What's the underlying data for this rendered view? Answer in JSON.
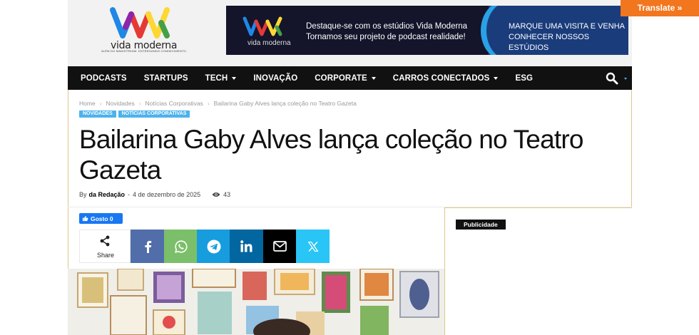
{
  "brand": {
    "logo_text": "vida moderna",
    "logo_tagline": "ALÉM DO MAINSTREAM. ENTREGANDO CONHECIMENTO.",
    "logo_colors": [
      "#1e88e5",
      "#e53935",
      "#fdd835",
      "#43a047",
      "#8e24aa"
    ]
  },
  "banner": {
    "logo_text": "vida moderna",
    "headline_line1": "Destaque-se com os estúdios Vida Moderna",
    "headline_line2": "Tornamos seu projeto de podcast realidade!",
    "cta_line1": "MARQUE UMA VISITA E VENHA",
    "cta_line2": "CONHECER NOSSOS ESTÚDIOS"
  },
  "translate": {
    "label": "Translate »"
  },
  "nav": {
    "items": [
      {
        "label": "PODCASTS",
        "dropdown": false
      },
      {
        "label": "STARTUPS",
        "dropdown": false
      },
      {
        "label": "TECH",
        "dropdown": true
      },
      {
        "label": "INOVAÇÃO",
        "dropdown": false
      },
      {
        "label": "CORPORATE",
        "dropdown": true
      },
      {
        "label": "CARROS CONECTADOS",
        "dropdown": true
      },
      {
        "label": "ESG",
        "dropdown": false
      }
    ],
    "search_icon": "search-icon"
  },
  "breadcrumb": {
    "items": [
      "Home",
      "Novidades",
      "Notícias Corporativas",
      "Bailarina Gaby Alves lança coleção no Teatro Gazeta"
    ],
    "separator": "›"
  },
  "tags": [
    "NOVIDADES",
    "NOTÍCIAS CORPORATIVAS"
  ],
  "article": {
    "title_line1": "Bailarina Gaby Alves lança coleção no Teatro",
    "title_line2": "Gazeta",
    "by": "By",
    "author": "da Redação",
    "dash": "-",
    "date": "4 de dezembro de 2025",
    "views": "43"
  },
  "like": {
    "label": "Gosto 0"
  },
  "share": {
    "label": "Share",
    "buttons": [
      {
        "name": "facebook",
        "icon": "facebook-icon",
        "color": "#516eab"
      },
      {
        "name": "whatsapp",
        "icon": "whatsapp-icon",
        "color": "#7bbf6a"
      },
      {
        "name": "telegram",
        "icon": "telegram-icon",
        "color": "#179cde"
      },
      {
        "name": "linkedin",
        "icon": "linkedin-icon",
        "color": "#0266a0"
      },
      {
        "name": "email",
        "icon": "email-icon",
        "color": "#000000"
      },
      {
        "name": "twitter",
        "icon": "x-icon",
        "color": "#29c5f6"
      }
    ]
  },
  "sidebar": {
    "ad_label": "Publicidade"
  },
  "colors": {
    "accent": "#4db2ec",
    "nav_bg": "#111111",
    "translate": "#f2761e",
    "like": "#1877f2"
  }
}
